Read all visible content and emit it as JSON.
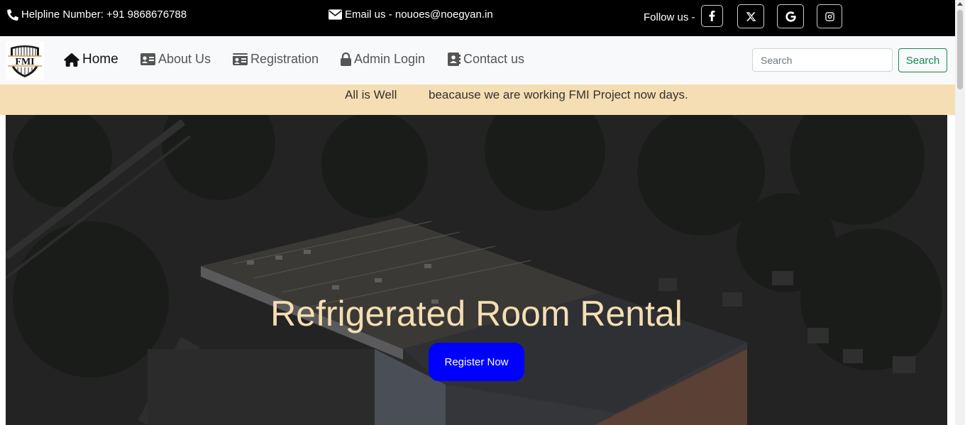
{
  "topbar": {
    "helpline": "Helpline Number: +91 9868676788",
    "email": "Email us - nouoes@noegyan.in",
    "follow_label": "Follow us -",
    "social": [
      "facebook-icon",
      "x-icon",
      "google-icon",
      "instagram-icon"
    ]
  },
  "nav": {
    "logo_text": "FMI",
    "items": [
      {
        "label": "Home",
        "icon": "home-icon"
      },
      {
        "label": "About Us",
        "icon": "id-card-icon"
      },
      {
        "label": "Registration",
        "icon": "id-card-icon"
      },
      {
        "label": "Admin Login",
        "icon": "lock-icon"
      },
      {
        "label": "Contact us",
        "icon": "contact-book-icon"
      }
    ],
    "search_placeholder": "Search",
    "search_button": "Search"
  },
  "marquee": {
    "text1": "All is Well",
    "text2": "beacause we are working FMI Project now days."
  },
  "hero": {
    "title": "Refrigerated Room Rental",
    "button": "Register Now"
  },
  "colors": {
    "topbar_bg": "#000000",
    "navbar_bg": "#f8f9fa",
    "marquee_bg": "#f5deb3",
    "hero_title": "#f5deb3",
    "register_button": "#0000ff",
    "search_button": "#198754"
  }
}
